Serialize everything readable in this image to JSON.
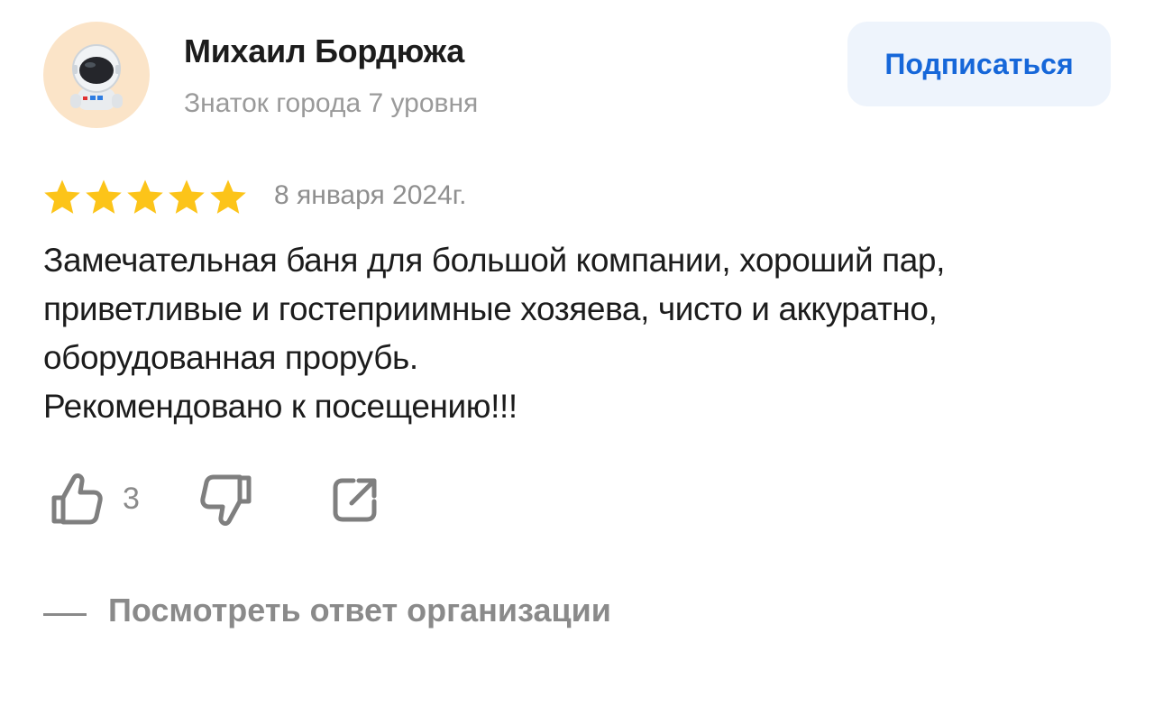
{
  "author": {
    "name": "Михаил Бордюжа",
    "level": "Знаток города 7 уровня",
    "avatar_icon": "astronaut-icon"
  },
  "subscribe": {
    "label": "Подписаться",
    "color": "#1667d9",
    "background": "#eef4fc"
  },
  "review": {
    "rating": 5,
    "rating_max": 5,
    "star_color": "#fcc419",
    "date": "8 января 2024г.",
    "text": "Замечательная баня для большой компании, хороший пар,\nприветливые и гостеприимные хозяева, чисто и аккуратно,\nоборудованная прорубь.\nРекомендовано к посещению!!!"
  },
  "actions": {
    "like_icon": "thumbs-up-icon",
    "like_count": "3",
    "dislike_icon": "thumbs-down-icon",
    "share_icon": "share-icon"
  },
  "org_response": {
    "label": "Посмотреть ответ организации"
  }
}
